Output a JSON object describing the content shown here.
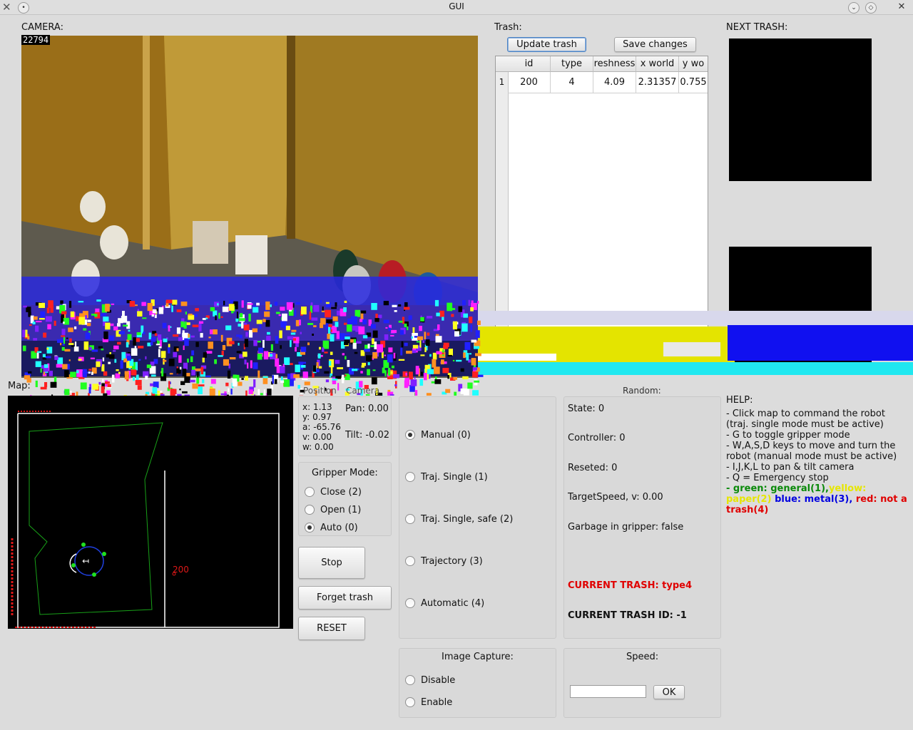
{
  "window": {
    "title": "GUI"
  },
  "camera": {
    "label": "CAMERA:",
    "counter": "22794"
  },
  "trash": {
    "label": "Trash:",
    "update_button": "Update trash",
    "save_button": "Save changes",
    "columns": [
      "id",
      "type",
      "reshness",
      "x world",
      "y wo"
    ],
    "rows": [
      {
        "num": "1",
        "cells": [
          "200",
          "4",
          "4.09",
          "2.31357",
          "0.755"
        ]
      }
    ]
  },
  "next_trash": {
    "label": "NEXT TRASH:"
  },
  "map": {
    "label": "Map:",
    "trash_marker": "200"
  },
  "tabs": {
    "position": "Position",
    "camera": "Camera",
    "random": "Random:"
  },
  "position": {
    "x": "x: 1.13",
    "y": "y: 0.97",
    "a": "a: -65.76",
    "v": "v: 0.00",
    "w": "w: 0.00"
  },
  "camera_status": {
    "pan": "Pan: 0.00",
    "tilt": "Tilt: -0.02"
  },
  "gripper": {
    "title": "Gripper Mode:",
    "options": [
      {
        "label": "Close (2)",
        "selected": false
      },
      {
        "label": "Open (1)",
        "selected": false
      },
      {
        "label": "Auto (0)",
        "selected": true
      }
    ]
  },
  "actions": {
    "stop": "Stop",
    "forget": "Forget trash",
    "reset": "RESET"
  },
  "control_modes": [
    {
      "label": "Manual (0)",
      "selected": true
    },
    {
      "label": "Traj. Single (1)",
      "selected": false
    },
    {
      "label": "Traj. Single, safe (2)",
      "selected": false
    },
    {
      "label": "Trajectory (3)",
      "selected": false
    },
    {
      "label": "Automatic (4)",
      "selected": false
    }
  ],
  "status": {
    "state": "State: 0",
    "controller": "Controller: 0",
    "reseted": "Reseted: 0",
    "target_speed": "TargetSpeed, v: 0.00",
    "garbage": "Garbage in gripper: false",
    "current_trash": "CURRENT TRASH: type4",
    "current_trash_id": "CURRENT TRASH ID: -1"
  },
  "image_capture": {
    "title": "Image Capture:",
    "options": [
      {
        "label": "Disable",
        "selected": false
      },
      {
        "label": "Enable",
        "selected": false
      }
    ]
  },
  "speed": {
    "title": "Speed:",
    "value": "",
    "ok": "OK"
  },
  "help": {
    "title": "HELP:",
    "lines": [
      "- Click map to command the robot (traj. single mode must be active)",
      "- G to toggle gripper mode",
      "- W,A,S,D keys to move and turn the robot (manual mode must be active)",
      "- I,J,K,L to pan & tilt camera",
      "- Q = Emergency stop"
    ],
    "legend": {
      "prefix": "- ",
      "green": "green: general(1),",
      "yellow": "yellow: paper(2)",
      "blue": "blue: metal(3),",
      "red": "red: not a trash(4)"
    }
  },
  "colors": {
    "green": "#0a8a0a",
    "yellow": "#e6e600",
    "blue": "#0000e0",
    "red": "#e00000"
  }
}
